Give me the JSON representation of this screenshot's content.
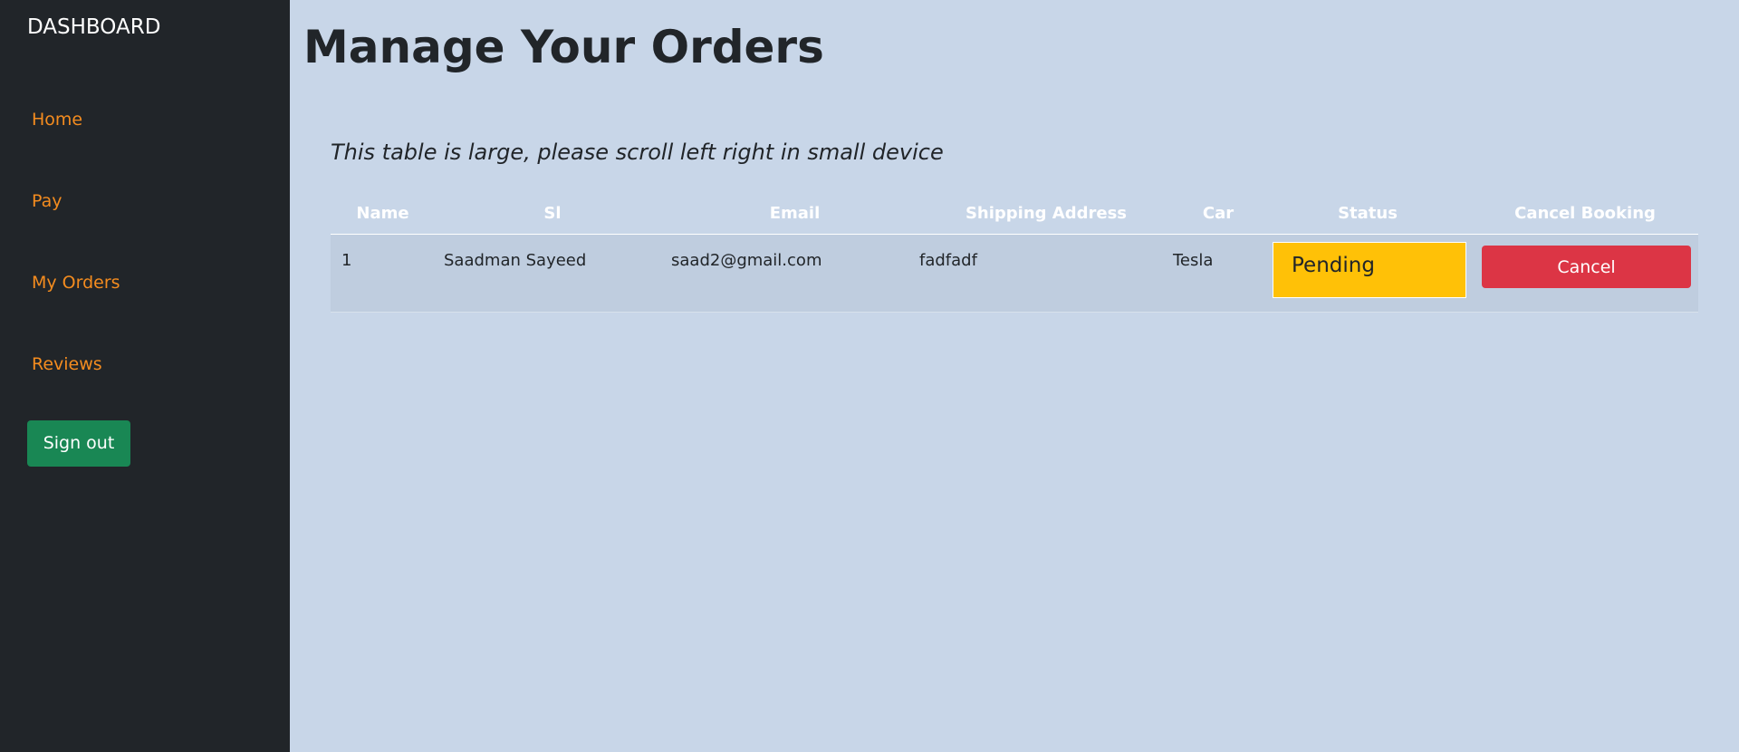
{
  "sidebar": {
    "brand": "DASHBOARD",
    "items": [
      {
        "label": "Home"
      },
      {
        "label": "Pay"
      },
      {
        "label": "My Orders"
      },
      {
        "label": "Reviews"
      }
    ],
    "signout_label": "Sign out"
  },
  "main": {
    "title": "Manage Your Orders",
    "scroll_note": "This table is large, please scroll left right in small device",
    "table": {
      "headers": [
        "Name",
        "Sl",
        "Email",
        "Shipping Address",
        "Car",
        "Status",
        "Cancel Booking"
      ],
      "rows": [
        {
          "index": "1",
          "name": "Saadman Sayeed",
          "email": "saad2@gmail.com",
          "address": "fadfadf",
          "car": "Tesla",
          "status": "Pending",
          "cancel_label": "Cancel"
        }
      ]
    }
  },
  "colors": {
    "sidebar_bg": "#212529",
    "main_bg": "#c8d6e8",
    "nav_link": "#f48c1f",
    "signout": "#198754",
    "status_pending": "#ffc107",
    "cancel": "#dc3545"
  }
}
